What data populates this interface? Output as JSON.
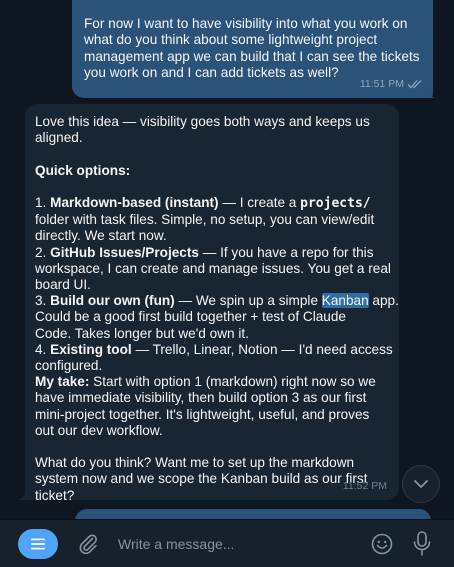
{
  "messages": {
    "outgoing_top": {
      "lines": [
        "",
        "For now I want to have visibility into what you work on",
        "what do you think about some lightweight project",
        "management app we can build that I can see the tickets",
        "you work on and I can add tickets as well?"
      ],
      "time": "11:51 PM"
    },
    "incoming": {
      "p1a": "Love this idea — visibility goes both ways and keeps us",
      "p1b": "aligned.",
      "heading": "Quick options:",
      "o1_num": "1. ",
      "o1_bold": "Markdown-based (instant)",
      "o1_rest_a": " — I create a ",
      "o1_code": "projects/",
      "o1_line2": "folder with task files. Simple, no setup, you can view/edit",
      "o1_line3": "directly. We start now.",
      "o2_num": "2. ",
      "o2_bold": "GitHub Issues/Projects",
      "o2_rest": " — If you have a repo for this",
      "o2_line2": "workspace, I can create and manage issues. You get a real",
      "o2_line3": "board UI.",
      "o3_num": "3. ",
      "o3_bold": "Build our own (fun)",
      "o3_rest_a": " — We spin up a simple ",
      "o3_hl": "Kanban",
      "o3_rest_b": " app.",
      "o3_line2": "Could be a good first build together + test of Claude",
      "o3_line3": "Code. Takes longer but we'd own it.",
      "o4_num": "4. ",
      "o4_bold": "Existing tool",
      "o4_rest": " — Trello, Linear, Notion — I'd need access",
      "o4_line2": "configured.",
      "take_bold": "My take:",
      "take_rest": " Start with option 1 (markdown) right now so we",
      "take_line2": "have immediate visibility, then build option 3 as our first",
      "take_line3": "mini-project together. It's lightweight, useful, and proves",
      "take_line4": "out our dev workflow.",
      "q_line1": "What do you think? Want me to set up the markdown",
      "q_line2": "system now and we scope the Kanban build as our first",
      "q_line3": "ticket?",
      "time": "11:52 PM"
    }
  },
  "composer": {
    "placeholder": "Write a message..."
  },
  "icons": {
    "menu": "menu-icon",
    "attach": "paperclip-icon",
    "emoji": "emoji-icon",
    "mic": "microphone-icon",
    "scroll": "chevron-down-icon",
    "read": "double-check-icon"
  },
  "colors": {
    "background": "#0e1621",
    "outgoing_bubble": "#2b5278",
    "incoming_bubble": "#182533",
    "accent": "#4ea4f6"
  }
}
